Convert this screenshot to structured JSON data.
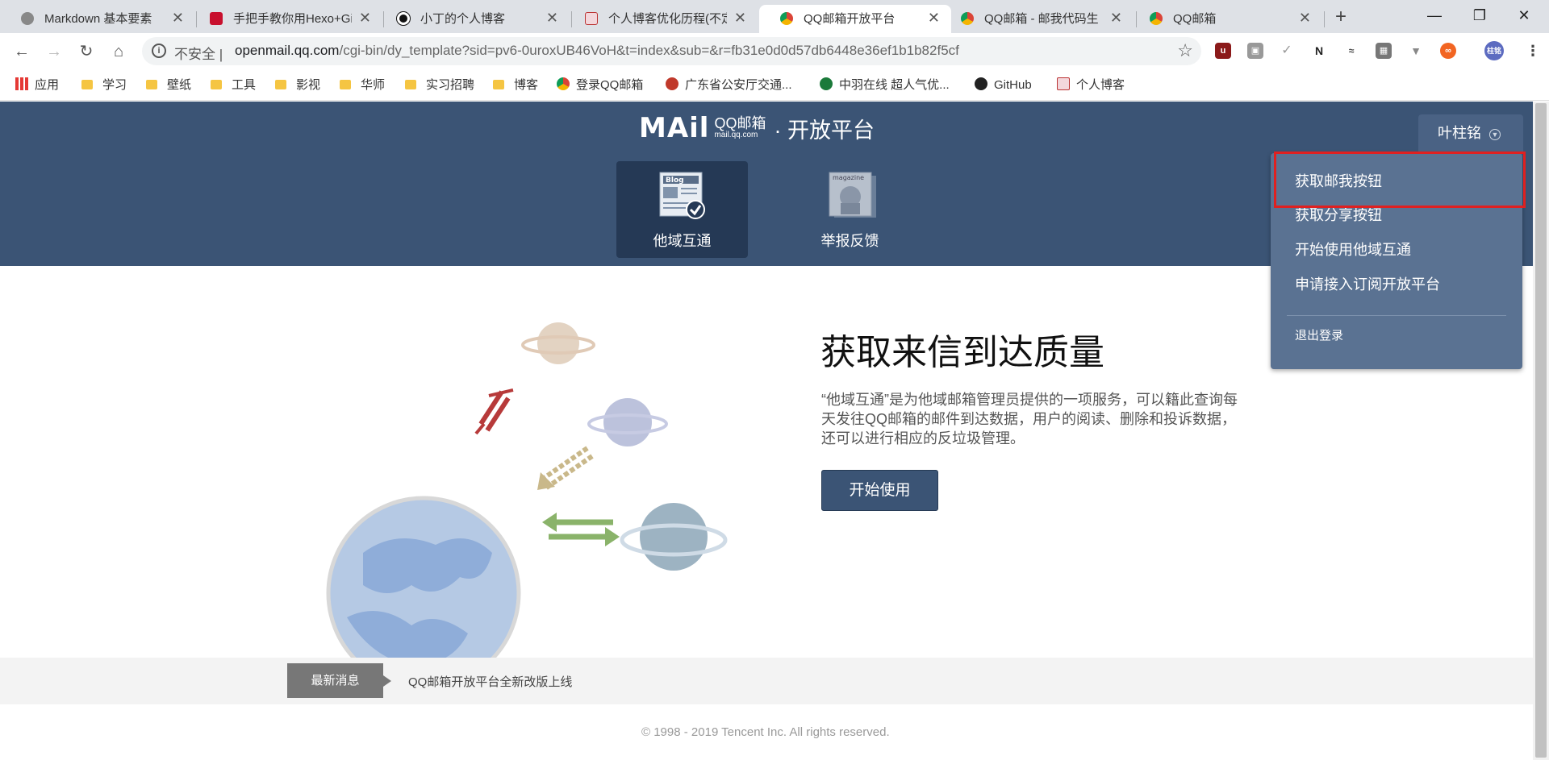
{
  "browser": {
    "tabs": [
      {
        "title": "Markdown 基本要素",
        "active": false
      },
      {
        "title": "手把手教你用Hexo+Gi",
        "active": false
      },
      {
        "title": "小丁的个人博客",
        "active": false
      },
      {
        "title": "个人博客优化历程(不定",
        "active": false
      },
      {
        "title": "QQ邮箱开放平台",
        "active": true
      },
      {
        "title": "QQ邮箱 - 邮我代码生",
        "active": false
      },
      {
        "title": "QQ邮箱",
        "active": false
      }
    ],
    "close_glyph": "✕",
    "new_tab_glyph": "+",
    "window_controls": {
      "minimize": "—",
      "maximize": "❐",
      "close": "✕"
    },
    "address": {
      "security_label": "不安全 |",
      "host": "openmail.qq.com",
      "path": "/cgi-bin/dy_template?sid=pv6-0uroxUB46VoH&t=index&sub=&r=fb31e0d0d57db6448e36ef1b1b82f5cf"
    },
    "profile_badge": "柱铭",
    "bookmarks": [
      {
        "label": "应用",
        "kind": "apps-icon"
      },
      {
        "label": "学习",
        "kind": "folder"
      },
      {
        "label": "壁纸",
        "kind": "folder"
      },
      {
        "label": "工具",
        "kind": "folder"
      },
      {
        "label": "影视",
        "kind": "folder"
      },
      {
        "label": "华师",
        "kind": "folder"
      },
      {
        "label": "实习招聘",
        "kind": "folder"
      },
      {
        "label": "博客",
        "kind": "folder"
      },
      {
        "label": "登录QQ邮箱",
        "kind": "chrome-icon"
      },
      {
        "label": "广东省公安厅交通...",
        "kind": "badge-icon"
      },
      {
        "label": "中羽在线 超人气优...",
        "kind": "b-icon"
      },
      {
        "label": "GitHub",
        "kind": "github-icon"
      },
      {
        "label": "个人博客",
        "kind": "mail-icon"
      }
    ]
  },
  "site": {
    "logo_mail": "MAil",
    "logo_qq": "QQ邮箱",
    "logo_domain": "mail.qq.com",
    "logo_platform": "· 开放平台",
    "nav": [
      {
        "label": "他域互通",
        "active": true,
        "icon": "blog-icon",
        "pic_text": "Blog"
      },
      {
        "label": "举报反馈",
        "active": false,
        "icon": "magazine-icon",
        "pic_text": "magazine"
      }
    ],
    "user_name": "叶柱铭",
    "menu": [
      {
        "label": "获取邮我按钮",
        "highlighted": true
      },
      {
        "label": "获取分享按钮",
        "highlighted": false
      },
      {
        "label": "开始使用他域互通",
        "highlighted": false
      },
      {
        "label": "申请接入订阅开放平台",
        "highlighted": false
      }
    ],
    "logout_label": "退出登录",
    "headline": "获取来信到达质量",
    "description": "“他域互通”是为他域邮箱管理员提供的一项服务，可以籍此查询每天发往QQ邮箱的邮件到达数据，用户的阅读、删除和投诉数据，还可以进行相应的反垃圾管理。",
    "start_button": "开始使用",
    "news_badge": "最新消息",
    "news_text": "QQ邮箱开放平台全新改版上线",
    "copyright": "© 1998 - 2019 Tencent Inc. All rights reserved."
  },
  "colors": {
    "header_bg": "#3b5475",
    "active_tile": "#253955",
    "dropdown_bg": "#5a7292",
    "highlight_border": "#e02020"
  }
}
